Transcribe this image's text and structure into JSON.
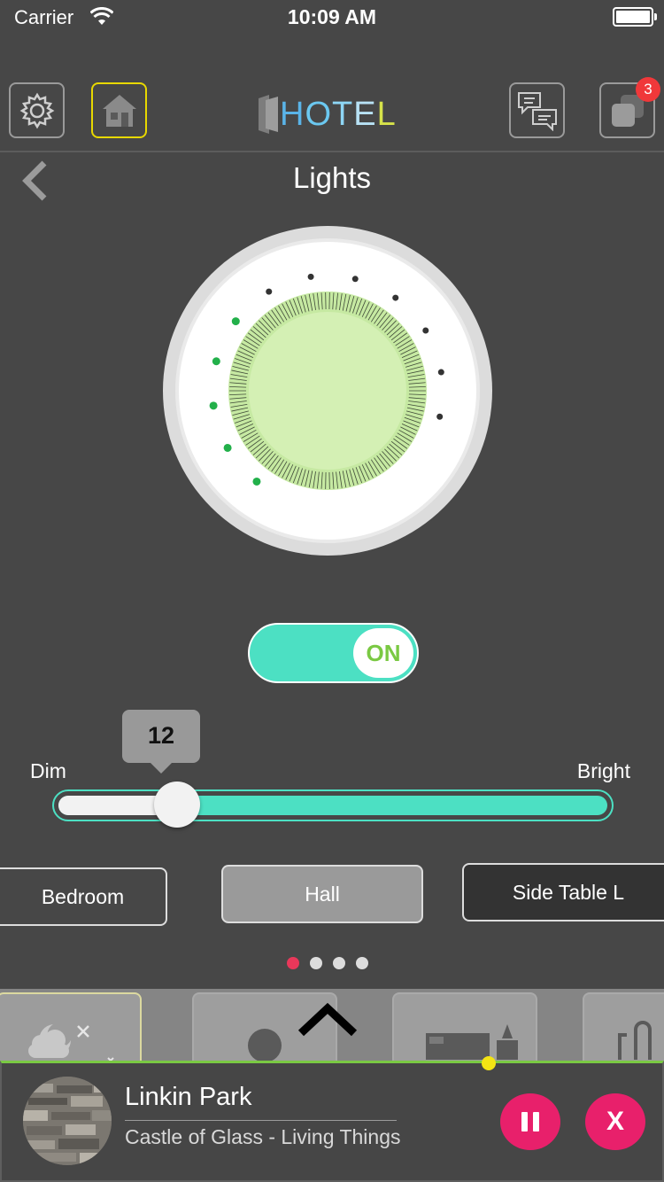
{
  "status_bar": {
    "carrier": "Carrier",
    "time": "10:09 AM"
  },
  "header": {
    "logo_text": "HOTEL",
    "notification_count": "3",
    "buttons": [
      "settings",
      "home",
      "messages",
      "apps"
    ]
  },
  "page": {
    "title": "Lights"
  },
  "dial": {
    "active_indicators": 5,
    "total_indicators": 12,
    "fill_color": "#d4f0b4",
    "active_color": "#22b04a"
  },
  "toggle": {
    "label": "ON",
    "state": "on",
    "color": "#4ce0c3"
  },
  "slider": {
    "value": "12",
    "value_num": 12,
    "max": 100,
    "min_label": "Dim",
    "max_label": "Bright"
  },
  "rooms": [
    {
      "label": "Bedroom"
    },
    {
      "label": "Hall"
    },
    {
      "label": "Side Table L"
    }
  ],
  "pager": {
    "count": 4,
    "active": 0
  },
  "player": {
    "artist": "Linkin Park",
    "song": "Castle of Glass - Living Things",
    "pause_icon": "pause-icon",
    "close_label": "X"
  },
  "colors": {
    "accent": "#4ce0c3",
    "pink": "#e8206b",
    "green": "#7ac943",
    "yellow": "#f4e414"
  }
}
